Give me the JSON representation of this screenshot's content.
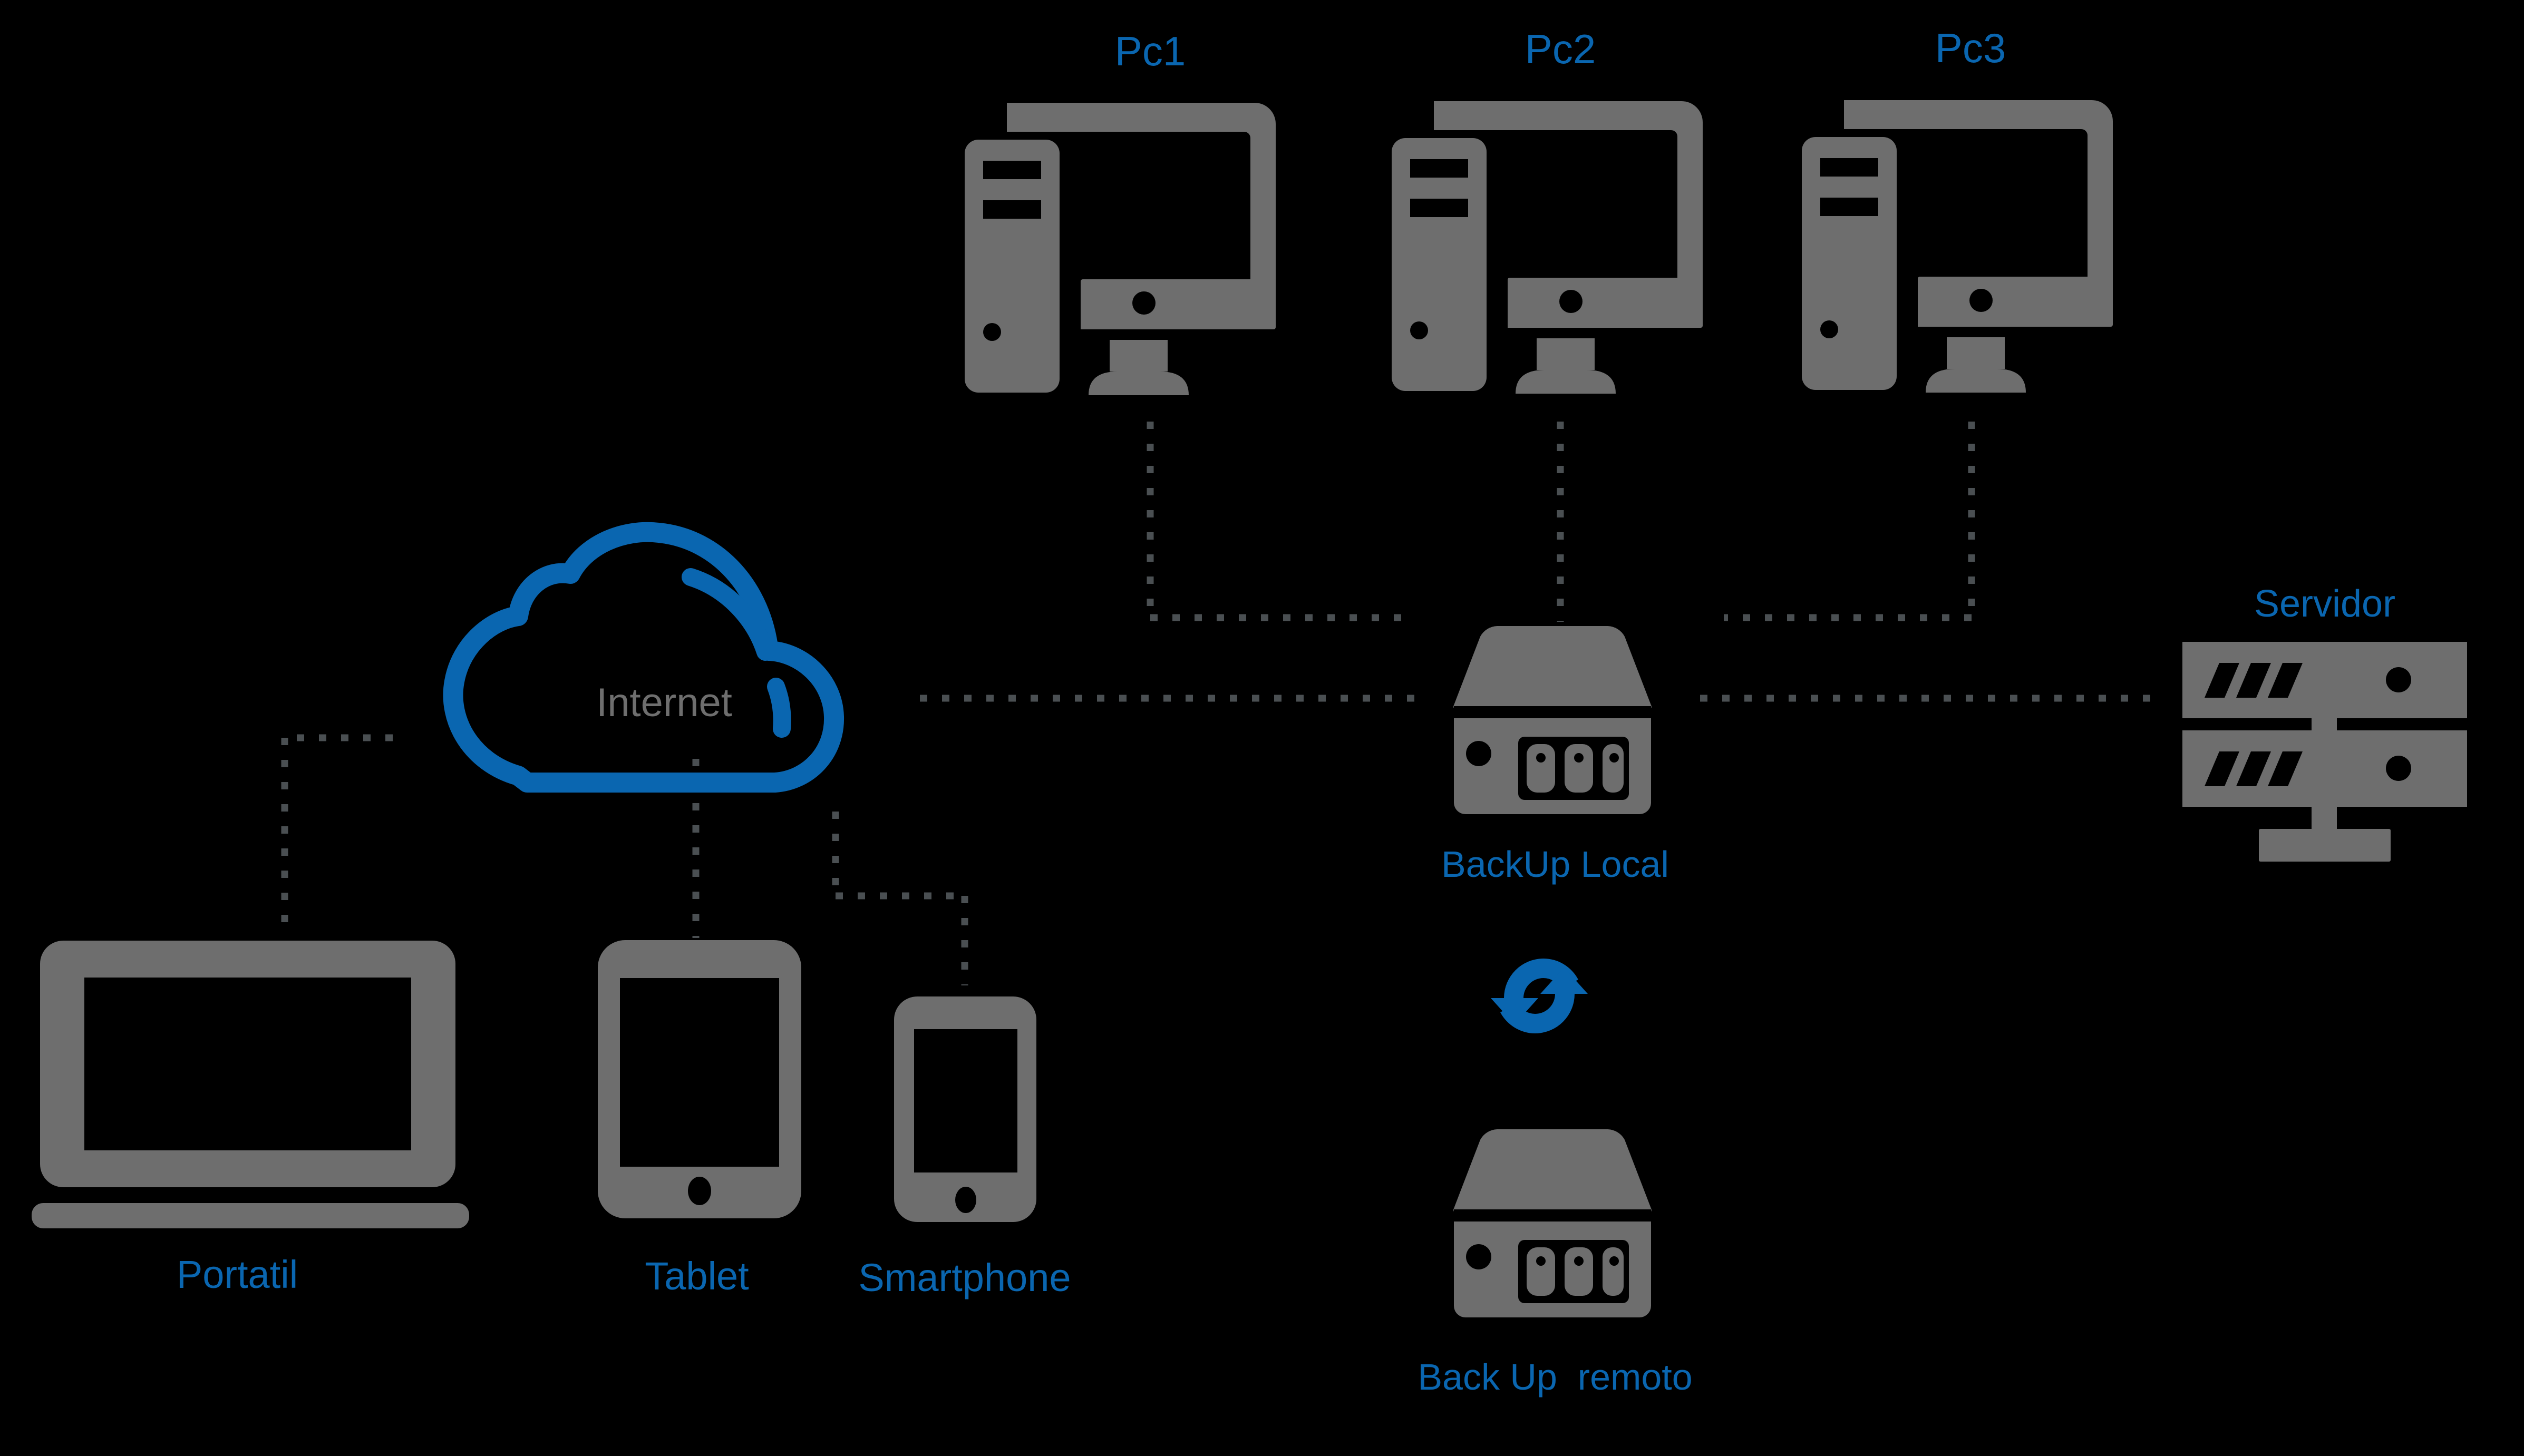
{
  "diagram": {
    "title": "Network backup diagram",
    "background_color": "#000000",
    "accent_color": "#0a66b0",
    "device_color": "#6e6e6e",
    "link_color": "#4a4f52"
  },
  "nodes": {
    "pc1": {
      "label": "Pc1",
      "icon": "desktop-computer-icon"
    },
    "pc2": {
      "label": "Pc2",
      "icon": "desktop-computer-icon"
    },
    "pc3": {
      "label": "Pc3",
      "icon": "desktop-computer-icon"
    },
    "internet": {
      "label": "Internet",
      "icon": "cloud-icon"
    },
    "backup_local": {
      "label": "BackUp Local",
      "icon": "nas-backup-icon"
    },
    "backup_remote": {
      "label": "Back Up  remoto",
      "icon": "nas-backup-icon"
    },
    "servidor": {
      "label": "Servidor",
      "icon": "server-rack-icon"
    },
    "portatil": {
      "label": "Portatil",
      "icon": "laptop-icon"
    },
    "tablet": {
      "label": "Tablet",
      "icon": "tablet-icon"
    },
    "smartphone": {
      "label": "Smartphone",
      "icon": "smartphone-icon"
    },
    "sync": {
      "label": "",
      "icon": "sync-arrows-icon"
    }
  },
  "connections": [
    {
      "from": "pc1",
      "to": "backup_local",
      "style": "dotted"
    },
    {
      "from": "pc2",
      "to": "backup_local",
      "style": "dotted"
    },
    {
      "from": "pc3",
      "to": "backup_local",
      "style": "dotted"
    },
    {
      "from": "internet",
      "to": "backup_local",
      "style": "dotted"
    },
    {
      "from": "backup_local",
      "to": "servidor",
      "style": "dotted"
    },
    {
      "from": "internet",
      "to": "portatil",
      "style": "dotted"
    },
    {
      "from": "internet",
      "to": "tablet",
      "style": "dotted"
    },
    {
      "from": "internet",
      "to": "smartphone",
      "style": "dotted"
    },
    {
      "from": "backup_local",
      "to": "backup_remote",
      "style": "sync"
    }
  ]
}
